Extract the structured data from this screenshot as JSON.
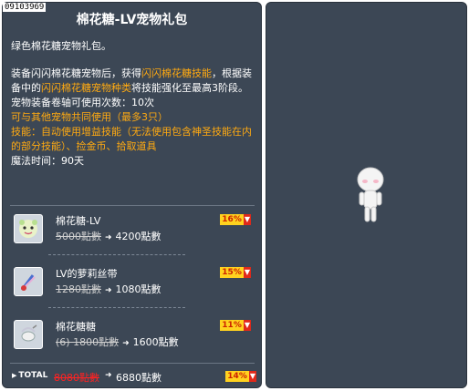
{
  "item_id": "09103969",
  "title": "棉花糖-LV宠物礼包",
  "description": {
    "line1": "绿色棉花糖宠物礼包。",
    "para_prefix": "装备闪闪棉花糖宠物后，获得",
    "skill_link": "闪闪棉花糖技能",
    "para_mid": "，根据装备中的",
    "type_link": "闪闪棉花糖宠物种类",
    "para_suffix": "将技能强化至最高3阶段。",
    "scroll_uses": "宠物装备卷轴可使用次数：10次",
    "share_note": "可与其他宠物共同使用（最多3只）",
    "skill_desc": "技能：自动使用增益技能（无法使用包含神圣技能在内的部分技能）、捡金币、拾取道具",
    "magic_time": "魔法时间：90天"
  },
  "package_items": [
    {
      "name": "棉花糖-LV",
      "original_price": "5000點數",
      "sale_price": "4200點數",
      "discount": "16%",
      "icon": "cotton-candy-pet-icon"
    },
    {
      "name": "LV的萝莉丝带",
      "original_price": "1280點數",
      "sale_price": "1080點數",
      "discount": "15%",
      "icon": "ribbon-icon"
    },
    {
      "name": "棉花糖糖",
      "original_price": "(6) 1800點數",
      "sale_price": "1600點數",
      "discount": "11%",
      "icon": "candy-icon"
    }
  ],
  "total": {
    "label": "TOTAL",
    "original_price": "8080點數",
    "sale_price": "6880點數",
    "discount": "14%"
  },
  "colors": {
    "panel_bg": "#3c4755",
    "highlight": "#ffaa11",
    "badge_bg": "#ffd21f",
    "badge_arrow": "#e0291a"
  }
}
